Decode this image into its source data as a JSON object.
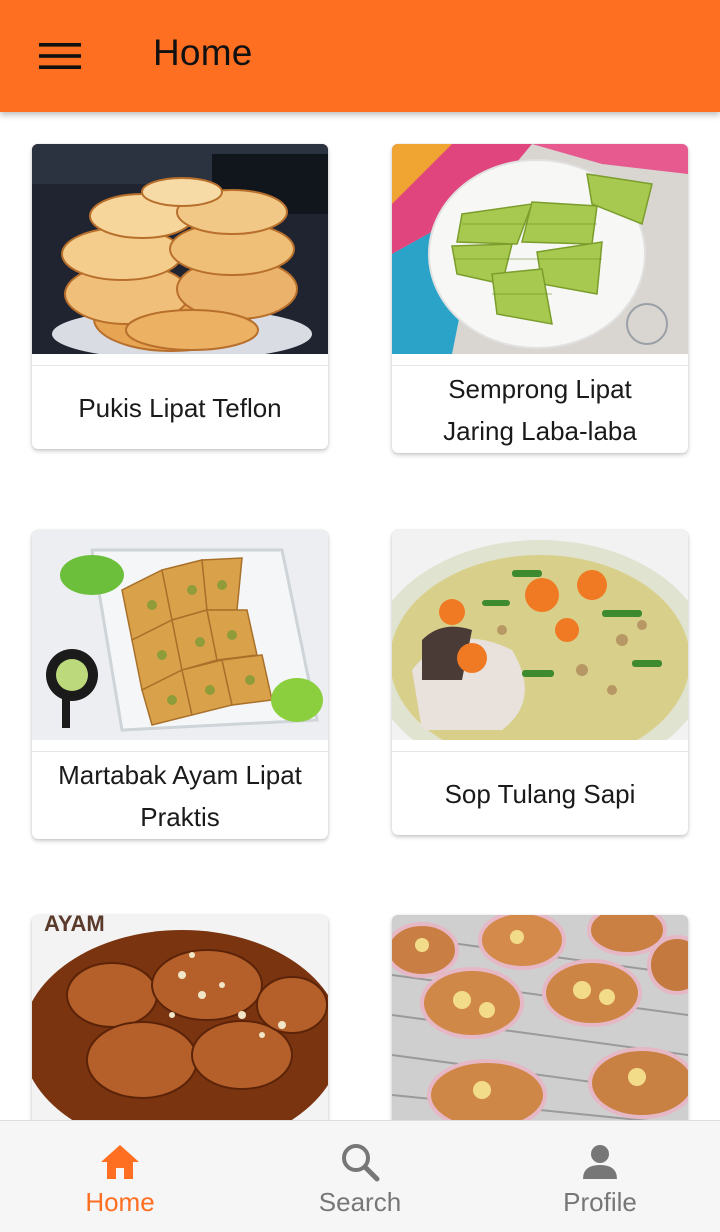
{
  "appbar": {
    "title": "Home",
    "menu_icon": "hamburger-menu-icon"
  },
  "recipes": [
    {
      "title": "Pukis Lipat Teflon"
    },
    {
      "title": "Semprong Lipat Jaring Laba-laba"
    },
    {
      "title": "Martabak Ayam Lipat Praktis"
    },
    {
      "title": "Sop Tulang Sapi"
    },
    {
      "photo_text": "AYAM"
    },
    {}
  ],
  "bottom_nav": {
    "items": [
      {
        "label": "Home",
        "icon": "home-icon",
        "active": true
      },
      {
        "label": "Search",
        "icon": "search-icon",
        "active": false
      },
      {
        "label": "Profile",
        "icon": "person-icon",
        "active": false
      }
    ]
  },
  "colors": {
    "accent": "#FF6F22",
    "inactive": "#777777"
  }
}
